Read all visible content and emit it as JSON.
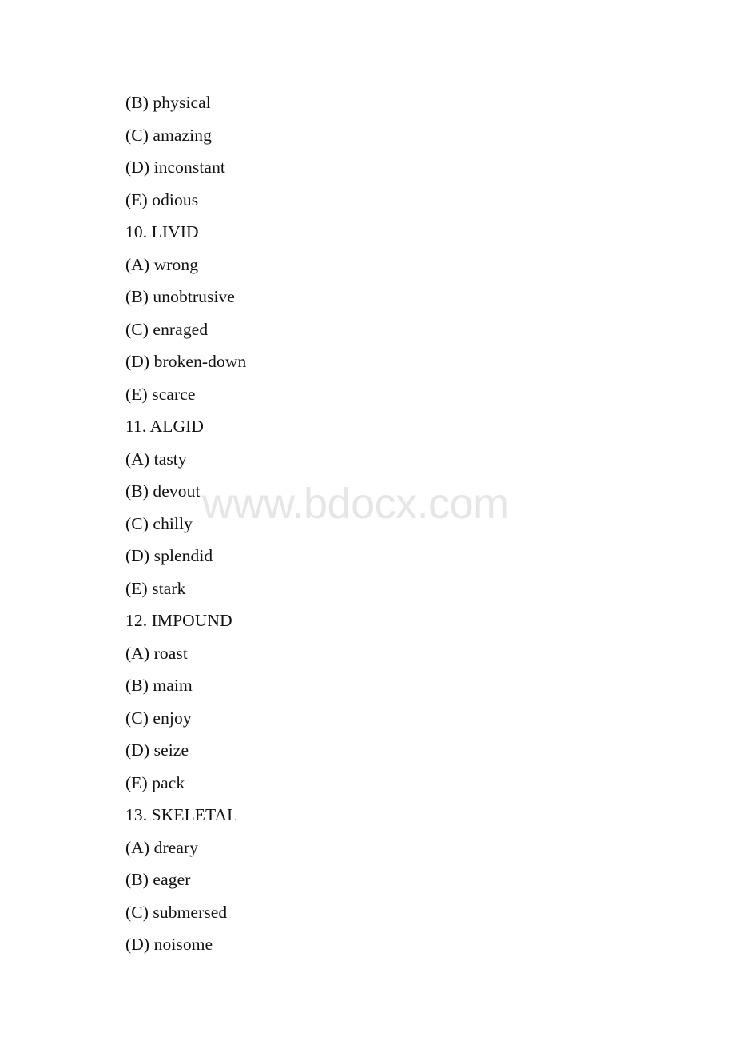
{
  "document": {
    "watermark": "www.bdocx.com",
    "watermark_color": "#e6e6e6",
    "text_color": "#121212",
    "background_color": "#ffffff",
    "lines": [
      {
        "text": "(B) physical",
        "kind": "option"
      },
      {
        "text": "(C) amazing",
        "kind": "option"
      },
      {
        "text": "(D) inconstant",
        "kind": "option"
      },
      {
        "text": "(E) odious",
        "kind": "option"
      },
      {
        "text": "10. LIVID",
        "kind": "heading"
      },
      {
        "text": "(A) wrong",
        "kind": "option"
      },
      {
        "text": "(B) unobtrusive",
        "kind": "option"
      },
      {
        "text": "(C) enraged",
        "kind": "option"
      },
      {
        "text": "(D) broken-down",
        "kind": "option"
      },
      {
        "text": "(E) scarce",
        "kind": "option"
      },
      {
        "text": "11. ALGID",
        "kind": "heading"
      },
      {
        "text": "(A) tasty",
        "kind": "option"
      },
      {
        "text": "(B) devout",
        "kind": "option"
      },
      {
        "text": "(C) chilly",
        "kind": "option"
      },
      {
        "text": "(D) splendid",
        "kind": "option"
      },
      {
        "text": "(E) stark",
        "kind": "option"
      },
      {
        "text": "12. IMPOUND",
        "kind": "heading"
      },
      {
        "text": "(A) roast",
        "kind": "option"
      },
      {
        "text": "(B) maim",
        "kind": "option"
      },
      {
        "text": "(C) enjoy",
        "kind": "option"
      },
      {
        "text": "(D) seize",
        "kind": "option"
      },
      {
        "text": "(E) pack",
        "kind": "option"
      },
      {
        "text": "13. SKELETAL",
        "kind": "heading"
      },
      {
        "text": "(A) dreary",
        "kind": "option"
      },
      {
        "text": "(B) eager",
        "kind": "option"
      },
      {
        "text": "(C) submersed",
        "kind": "option"
      },
      {
        "text": "(D) noisome",
        "kind": "option"
      }
    ]
  }
}
